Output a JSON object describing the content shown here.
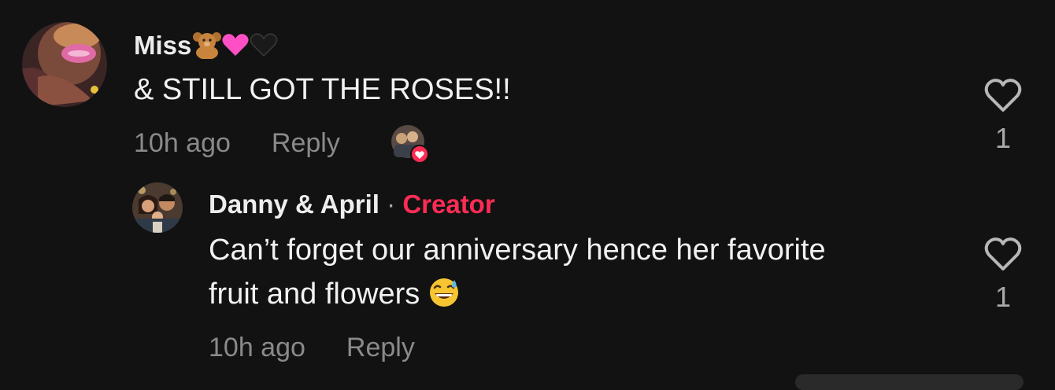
{
  "comments": [
    {
      "username": "Miss",
      "username_emojis": [
        "teddy-bear-emoji",
        "pink-heart-emoji",
        "black-heart-emoji"
      ],
      "text": "& STILL GOT THE ROSES!!",
      "time": "10h ago",
      "reply_label": "Reply",
      "likes": "1",
      "creator_liked": true
    },
    {
      "username": "Danny & April",
      "separator": "·",
      "badge": "Creator",
      "text_line1": "Can’t forget our anniversary hence her favorite",
      "text_line2": "fruit and flowers",
      "text_emoji": "grinning-face-with-sweat-emoji",
      "time": "10h ago",
      "reply_label": "Reply",
      "likes": "1"
    }
  ],
  "colors": {
    "background": "#121212",
    "creator_accent": "#fe2c55",
    "meta_text": "#8a8a8a"
  }
}
